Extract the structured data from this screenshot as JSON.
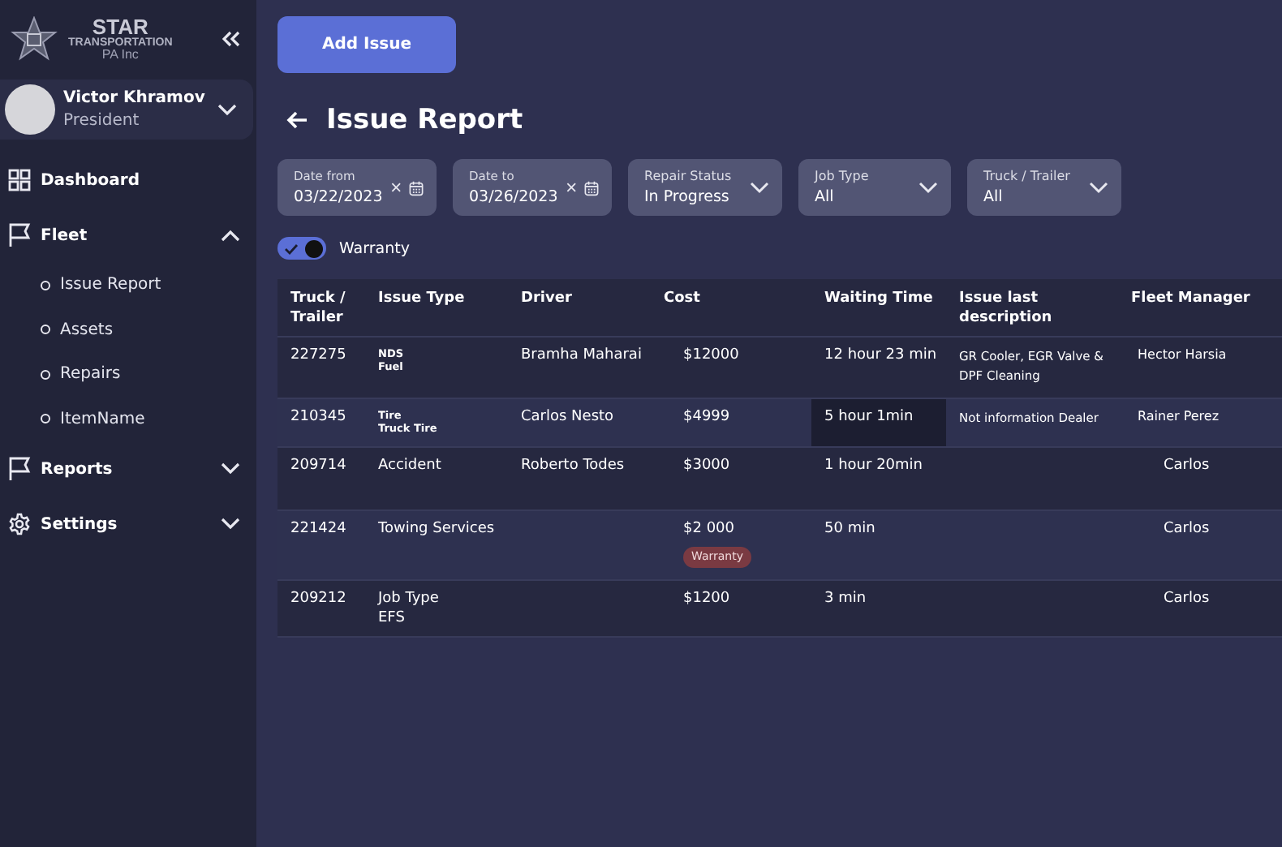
{
  "logo": {
    "title": "STAR",
    "subtitle": "TRANSPORTATION",
    "tagline": "PA Inc"
  },
  "user": {
    "name": "Victor Khramov",
    "role": "President",
    "expanded": false
  },
  "nav": [
    {
      "label": "Dashboard",
      "kind": "dashboard"
    },
    {
      "label": "Fleet",
      "kind": "section",
      "expanded": true,
      "children": [
        {
          "label": "Issue Report"
        },
        {
          "label": "Assets"
        },
        {
          "label": "Repairs"
        },
        {
          "label": "ItemName"
        }
      ]
    },
    {
      "label": "Reports",
      "kind": "section",
      "expanded": false
    },
    {
      "label": "Settings",
      "kind": "settings",
      "expanded": false
    }
  ],
  "add_button": "Add Issue",
  "title": "Issue Report",
  "filters": [
    {
      "kind": "date",
      "label": "Date from",
      "value": "03/22/2023"
    },
    {
      "kind": "date",
      "label": "Date to",
      "value": "03/26/2023"
    },
    {
      "kind": "select",
      "label": "Repair Status",
      "value": "In Progress"
    },
    {
      "kind": "select",
      "label": "Job Type",
      "value": "All"
    },
    {
      "kind": "select",
      "label": "Truck / Trailer",
      "value": "All"
    }
  ],
  "warranty_toggle": {
    "label": "Warranty",
    "on": true
  },
  "table": {
    "columns": [
      "Truck / Trailer",
      "Issue Type",
      "Driver",
      "Cost",
      "Waiting Time",
      "Issue last description",
      "Fleet Manager"
    ],
    "rows": [
      {
        "truck": "227275",
        "kind": "compact",
        "issue_type": [
          "NDS",
          "Fuel"
        ],
        "driver": "Bramha Maharai",
        "cost": "$12000",
        "waiting": "12 hour 23 min",
        "waiting_highlight": false,
        "description": "GR Cooler, EGR Valve & DPF Cleaning",
        "manager": "Hector Harsia"
      },
      {
        "truck": "210345",
        "kind": "compact",
        "issue_type": [
          "Tire",
          "Truck Tire"
        ],
        "driver": "Carlos Nesto",
        "cost": "$4999",
        "waiting": "5 hour 1min",
        "waiting_highlight": true,
        "description": "Not information Dealer",
        "manager": "Rainer Perez"
      },
      {
        "truck": "209714",
        "kind": "plain",
        "issue_type": [
          "Accident"
        ],
        "driver": "Roberto Todes",
        "cost": "$3000",
        "waiting": "1 hour 20min",
        "waiting_highlight": false,
        "manager": "Carlos"
      },
      {
        "truck": "221424",
        "kind": "plain",
        "issue_type": [
          "Towing Services"
        ],
        "cost": "$2 000",
        "badge": "Warranty",
        "waiting": "50 min",
        "waiting_highlight": false,
        "manager": "Carlos"
      },
      {
        "truck": "209212",
        "kind": "plain",
        "issue_type": [
          "Job Type",
          "EFS"
        ],
        "cost": "$1200",
        "waiting": "3 min",
        "waiting_highlight": false,
        "manager": "Carlos"
      }
    ]
  }
}
